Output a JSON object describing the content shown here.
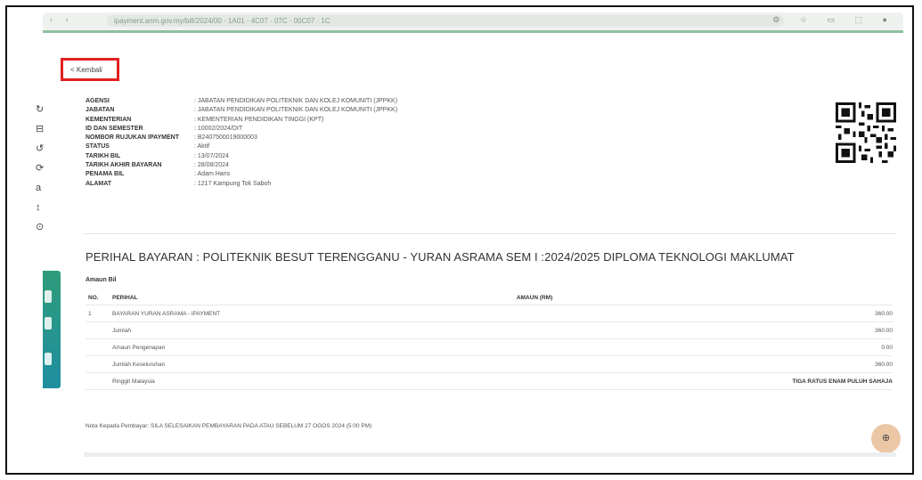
{
  "browser": {
    "nav_glyphs": "‹ ›",
    "url": "ipayment.anm.gov.my/bill/2024/00 · 1A01 · 4C07 · 07C · 00C07 · 1C",
    "right_glyphs": "⚙ ☆ ▭ ⬚ ●"
  },
  "back": {
    "label": "< Kembali"
  },
  "sidebar": {
    "glyphs": [
      "↻",
      "⊟",
      "↺",
      "⟳",
      "a",
      "↕",
      "⊙"
    ]
  },
  "info": [
    {
      "label": "AGENSI",
      "value": ": JABATAN PENDIDIKAN POLITEKNIK DAN KOLEJ KOMUNITI (JPPKK)"
    },
    {
      "label": "JABATAN",
      "value": ": JABATAN PENDIDIKAN POLITEKNIK DAN KOLEJ KOMUNITI (JPPKK)"
    },
    {
      "label": "KEMENTERIAN",
      "value": ": KEMENTERIAN PENDIDIKAN TINGGI (KPT)"
    },
    {
      "label": "ID DAN SEMESTER",
      "value": ": 10002/2024/DIT"
    },
    {
      "label": "NOMBOR RUJUKAN IPAYMENT",
      "value": ": B2407500019000003"
    },
    {
      "label": "STATUS",
      "value": ": Aktif"
    },
    {
      "label": "TARIKH BIL",
      "value": ": 13/07/2024"
    },
    {
      "label": "TARIKH AKHIR BAYARAN",
      "value": ": 28/08/2024"
    },
    {
      "label": "PENAMA BIL",
      "value": ": Adam Haris"
    },
    {
      "label": "ALAMAT",
      "value": ": 1217 Kampung Tok Saboh"
    }
  ],
  "perihal_title": "PERIHAL BAYARAN : POLITEKNIK BESUT TERENGGANU - YURAN ASRAMA SEM I :2024/2025 DIPLOMA TEKNOLOGI MAKLUMAT",
  "amaun_bil": "Amaun Bil",
  "table": {
    "headers": {
      "no": "NO.",
      "perihal": "PERIHAL",
      "amaun": "AMAUN (RM)"
    },
    "rows": [
      {
        "no": "1",
        "perihal": "BAYARAN YURAN ASRAMA - IPAYMENT",
        "amaun": "360.00"
      },
      {
        "no": "",
        "perihal": "Jumlah",
        "amaun": "360.00"
      },
      {
        "no": "",
        "perihal": "Amaun Pengenapan",
        "amaun": "0.00"
      },
      {
        "no": "",
        "perihal": "Jumlah Keseluruhan",
        "amaun": "360.00"
      },
      {
        "no": "",
        "perihal": "Ringgit Malaysia",
        "amaun": "TIGA RATUS ENAM PULUH SAHAJA"
      }
    ]
  },
  "nota": "Nota Kepada Pembayar: SILA SELESAIKAN PEMBAYARAN PADA ATAU SEBELUM 27 OGOS 2024 (5:00 PM)",
  "fab": {
    "icon": "support-icon",
    "glyph": "⊕"
  },
  "colors": {
    "accent": "#8fbf9f",
    "highlight": "#e32020",
    "fab": "#ecc7a6",
    "sidebar": "#2e9c7a"
  }
}
